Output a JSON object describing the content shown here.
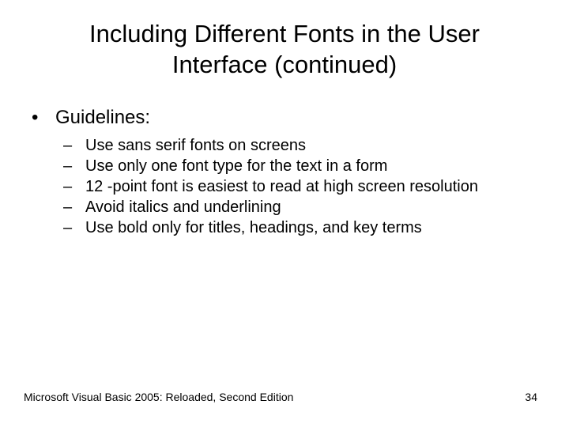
{
  "title": "Including Different Fonts in the User Interface (continued)",
  "bullet_top": "Guidelines:",
  "items": [
    "Use sans serif fonts on screens",
    "Use only one font type for the text in a form",
    "12 -point font is easiest to read at high screen resolution",
    "Avoid italics and underlining",
    "Use bold only for titles, headings, and key terms"
  ],
  "footer": "Microsoft Visual Basic 2005: Reloaded, Second Edition",
  "page": "34"
}
